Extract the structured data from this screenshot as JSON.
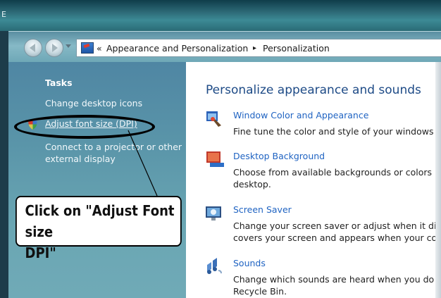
{
  "window": {
    "title_letter": "E"
  },
  "nav": {
    "back_icon": "back-arrow-icon",
    "forward_icon": "forward-arrow-icon",
    "breadcrumb_chevron": "«",
    "breadcrumb_items": [
      "Appearance and Personalization",
      "Personalization"
    ],
    "breadcrumb_separator": "▸"
  },
  "sidebar": {
    "heading": "Tasks",
    "links": [
      {
        "label": "Change desktop icons"
      },
      {
        "label": "Adjust font size (DPI)"
      },
      {
        "label": "Connect to a projector or other external display"
      }
    ]
  },
  "annotation": {
    "callout_line1": "Click on \"Adjust Font size",
    "callout_line2": "DPI\""
  },
  "main": {
    "title": "Personalize appearance and sounds",
    "items": [
      {
        "icon": "window-color-icon",
        "link": "Window Color and Appearance",
        "desc": "Fine tune the color and style of your windows"
      },
      {
        "icon": "desktop-background-icon",
        "link": "Desktop Background",
        "desc": "Choose from available backgrounds or colors desktop."
      },
      {
        "icon": "screen-saver-icon",
        "link": "Screen Saver",
        "desc": "Change your screen saver or adjust when it di covers your screen and appears when your co"
      },
      {
        "icon": "sounds-icon",
        "link": "Sounds",
        "desc": "Change which sounds are heard when you do Recycle Bin."
      }
    ]
  },
  "colors": {
    "sidebar": "#5a95a9",
    "link_blue": "#1f63c2",
    "title_blue": "#1d4a86"
  }
}
